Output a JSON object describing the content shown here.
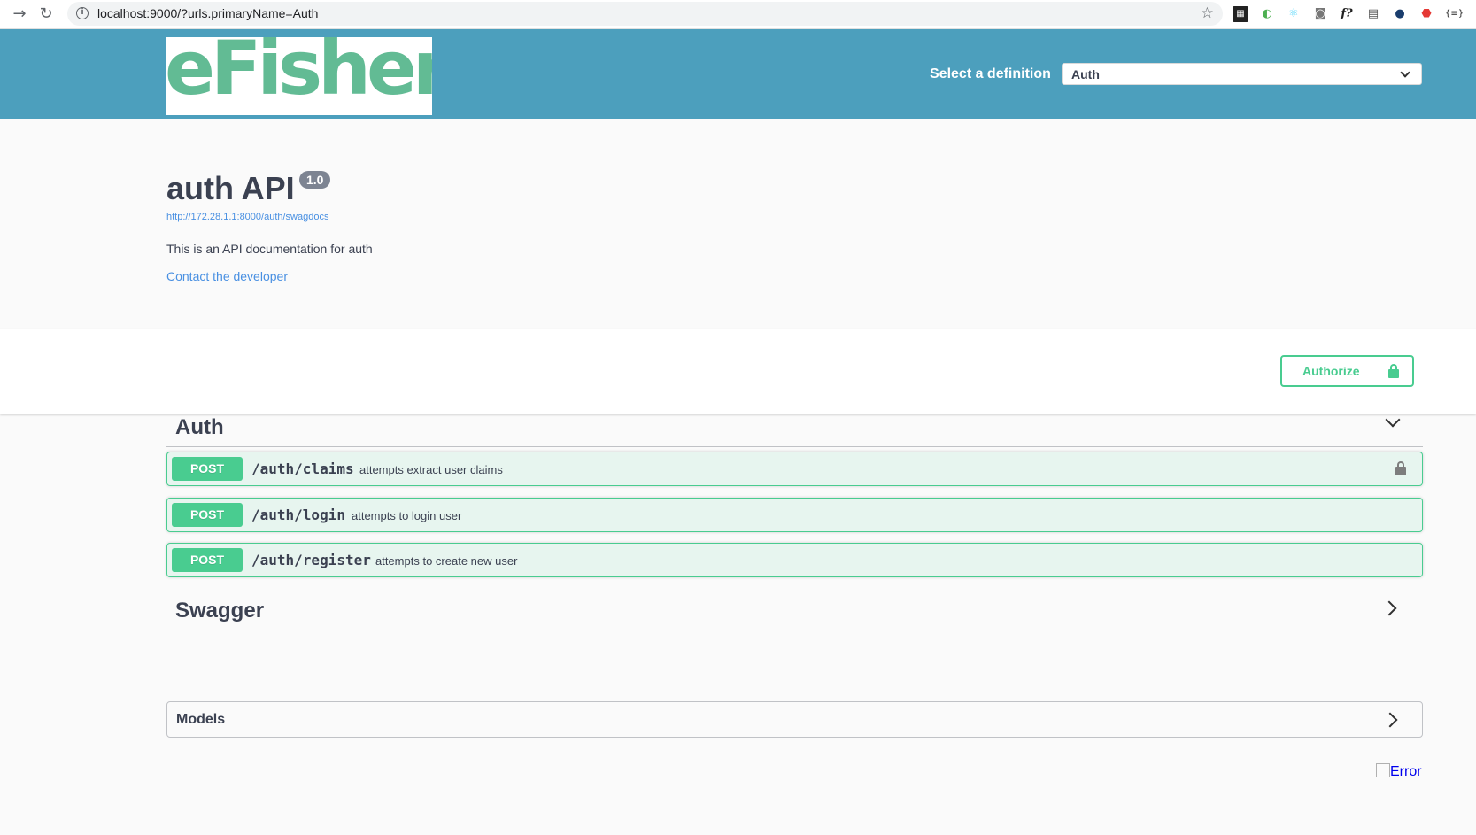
{
  "browser": {
    "url": "localhost:9000/?urls.primaryName=Auth"
  },
  "topbar": {
    "logo_text": "eFishery",
    "definition_label": "Select a definition",
    "definition_selected": "Auth"
  },
  "info": {
    "title": "auth API",
    "version": "1.0",
    "spec_url": "http://172.28.1.1:8000/auth/swagdocs",
    "description": "This is an API documentation for auth",
    "contact": "Contact the developer"
  },
  "scheme": {
    "authorize_label": "Authorize"
  },
  "tags": [
    {
      "name": "Auth",
      "expanded": true,
      "operations": [
        {
          "method": "POST",
          "path": "/auth/claims",
          "summary": "attempts extract user claims",
          "locked": true
        },
        {
          "method": "POST",
          "path": "/auth/login",
          "summary": "attempts to login user",
          "locked": false
        },
        {
          "method": "POST",
          "path": "/auth/register",
          "summary": "attempts to create new user",
          "locked": false
        }
      ]
    },
    {
      "name": "Swagger",
      "expanded": false,
      "operations": []
    }
  ],
  "models": {
    "label": "Models"
  },
  "footer": {
    "error_alt": "Error"
  },
  "colors": {
    "topbar": "#4c9fbd",
    "post": "#49cc90",
    "link": "#4990e2",
    "text": "#3b4151"
  }
}
